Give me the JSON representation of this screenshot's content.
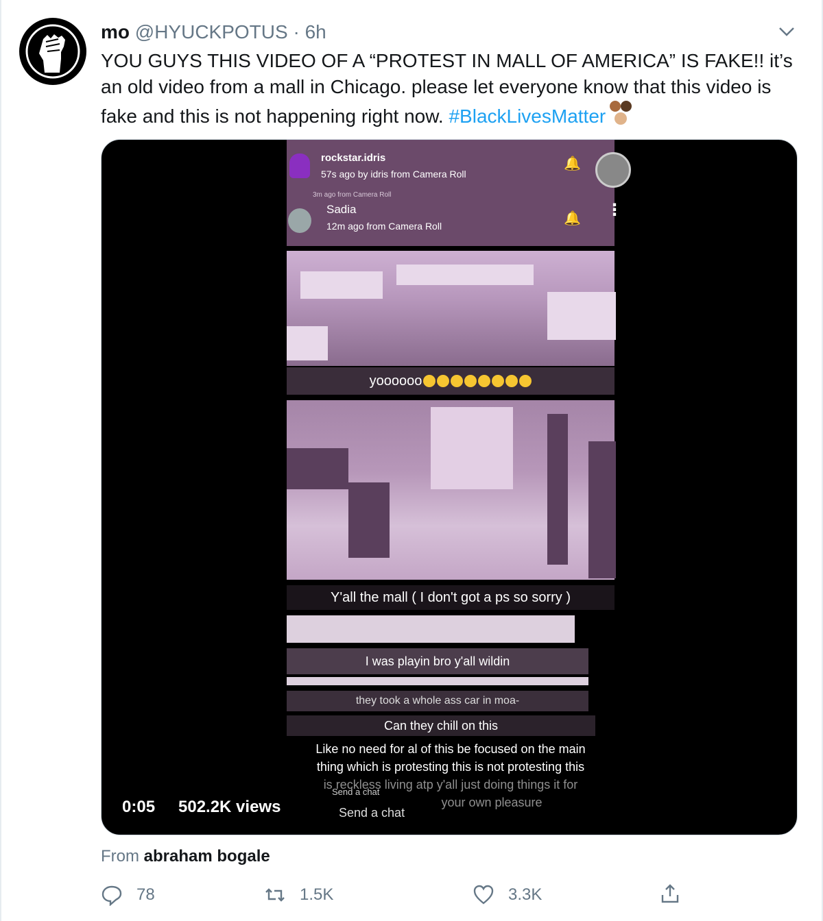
{
  "tweet": {
    "author_name": "mo",
    "handle": "@HYUCKPOTUS",
    "separator": "·",
    "time": "6h",
    "text": "YOU GUYS THIS VIDEO OF A “PROTEST IN MALL OF AMERICA” IS FAKE!! it’s an old video from a mall in Chicago. please let everyone know that this video is fake and this is not happening right now. ",
    "hashtag": "#BlackLivesMatter",
    "avatar_icon": "raised-fist-icon",
    "menu_icon": "chevron-down-icon"
  },
  "video": {
    "timecode": "0:05",
    "views": "502.2K views",
    "snap": {
      "top_user": "rockstar.idris",
      "top_sub": "57s ago by idris  from Camera Roll",
      "clipped_line": "3m ago from Camera Roll",
      "user": "Sadia",
      "user_time": "12m ago from Camera Roll",
      "caption_1": "yoooooo",
      "caption_2": "Y'all the mall ( I don't got a ps so sorry )",
      "caption_3": "I was playin bro y'all wildin",
      "caption_4": "they took a whole ass car in moa-",
      "caption_5": "Can they chill on this",
      "caption_6a": "Like no need for al of this be focused on the main",
      "caption_6b": "thing which is protesting this is not protesting this",
      "caption_6c": "is reckless living atp y'all just doing things it for",
      "caption_6d": "your own pleasure",
      "chat_small": "Send a chat",
      "chat": "Send a chat"
    }
  },
  "attribution": {
    "prefix": "From ",
    "source": "abraham bogale"
  },
  "actions": {
    "reply_count": "78",
    "retweet_count": "1.5K",
    "like_count": "3.3K"
  },
  "colors": {
    "link": "#1da1f2",
    "secondary": "#657786",
    "primary_text": "#14171a"
  }
}
